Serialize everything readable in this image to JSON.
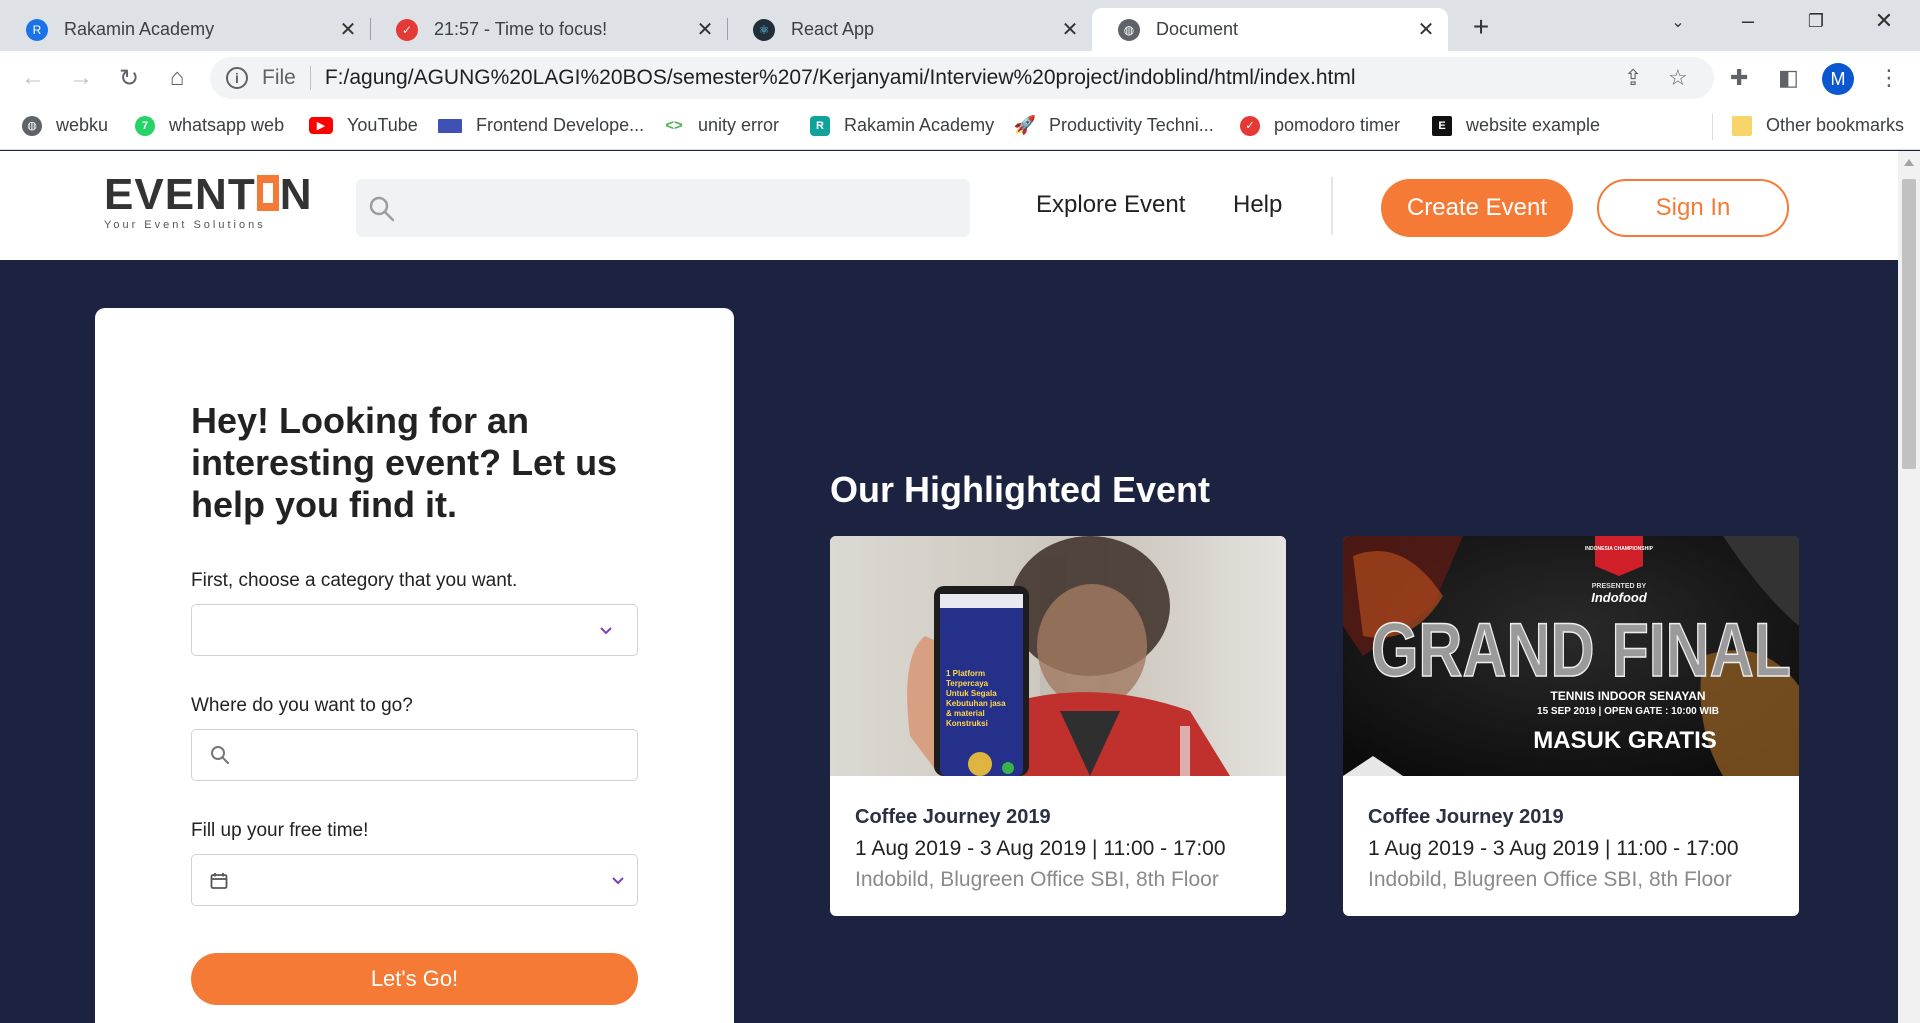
{
  "browser": {
    "tabs": [
      {
        "title": "Rakamin Academy",
        "icon": "rakamin-icon",
        "color": "#1a73e8"
      },
      {
        "title": "21:57 - Time to focus!",
        "icon": "pomodoro-icon",
        "color": "#e53935"
      },
      {
        "title": "React App",
        "icon": "react-icon",
        "color": "#222f3a"
      },
      {
        "title": "Document",
        "icon": "globe-icon",
        "color": "#5f6368"
      }
    ],
    "address": {
      "scheme_label": "File",
      "url": "F:/agung/AGUNG%20LAGI%20BOS/semester%207/Kerjanyami/Interview%20project/indoblind/html/index.html"
    },
    "profile_initial": "M",
    "bookmarks": [
      {
        "label": "webku",
        "icon": "globe-icon",
        "color": "#5f6368"
      },
      {
        "label": "whatsapp web",
        "icon": "whatsapp-icon",
        "color": "#25d366"
      },
      {
        "label": "YouTube",
        "icon": "youtube-icon",
        "color": "#ff0000"
      },
      {
        "label": "Frontend Develope...",
        "icon": "frontend-icon",
        "color": "#3f51b5"
      },
      {
        "label": "unity error",
        "icon": "code-icon",
        "color": "#4caf50"
      },
      {
        "label": "Rakamin Academy",
        "icon": "rakamin-icon",
        "color": "#10a39b"
      },
      {
        "label": "Productivity Techni...",
        "icon": "rocket-icon",
        "color": "#3f51b5"
      },
      {
        "label": "pomodoro timer",
        "icon": "pomodoro-icon",
        "color": "#e53935"
      },
      {
        "label": "website example",
        "icon": "e-icon",
        "color": "#111111"
      }
    ],
    "other_bookmarks": "Other bookmarks"
  },
  "site": {
    "logo": {
      "text_before": "EVENT",
      "text_after": "N",
      "tagline": "Your Event Solutions"
    },
    "search_placeholder": "",
    "nav": {
      "explore": "Explore Event",
      "help": "Help",
      "create": "Create Event",
      "signin": "Sign In"
    },
    "accent": "#f47a35",
    "background": "#1b2341"
  },
  "finder": {
    "heading": "Hey! Looking for an interesting event? Let us help you find it.",
    "category_label": "First, choose a category that you want.",
    "category_value": "",
    "location_label": "Where do you want to go?",
    "location_value": "",
    "time_label": "Fill up your free time!",
    "time_value": "",
    "submit": "Let's Go!"
  },
  "highlight": {
    "title": "Our Highlighted Event",
    "events": [
      {
        "name": "Coffee Journey 2019",
        "date": "1 Aug 2019 - 3 Aug 2019 | 11:00 - 17:00",
        "location": "Indobild, Blugreen Office SBI, 8th Floor",
        "phone_lines": [
          "1 Platform",
          "Terpercaya",
          "Untuk Segala",
          "Kebutuhan jasa",
          "& material",
          "Konstruksi"
        ]
      },
      {
        "name": "Coffee Journey 2019",
        "date": "1 Aug 2019 - 3 Aug 2019 | 11:00 - 17:00",
        "location": "Indobild, Blugreen Office SBI, 8th Floor",
        "poster": {
          "badge": "INDONESIA CHAMPIONSHIP",
          "presented": "PRESENTED BY",
          "sponsor": "Indofood",
          "headline": "GRAND FINAL",
          "venue": "TENNIS INDOOR SENAYAN",
          "when": "15 SEP 2019 | OPEN GATE : 10:00 WIB",
          "cta": "MASUK GRATIS"
        }
      }
    ]
  }
}
